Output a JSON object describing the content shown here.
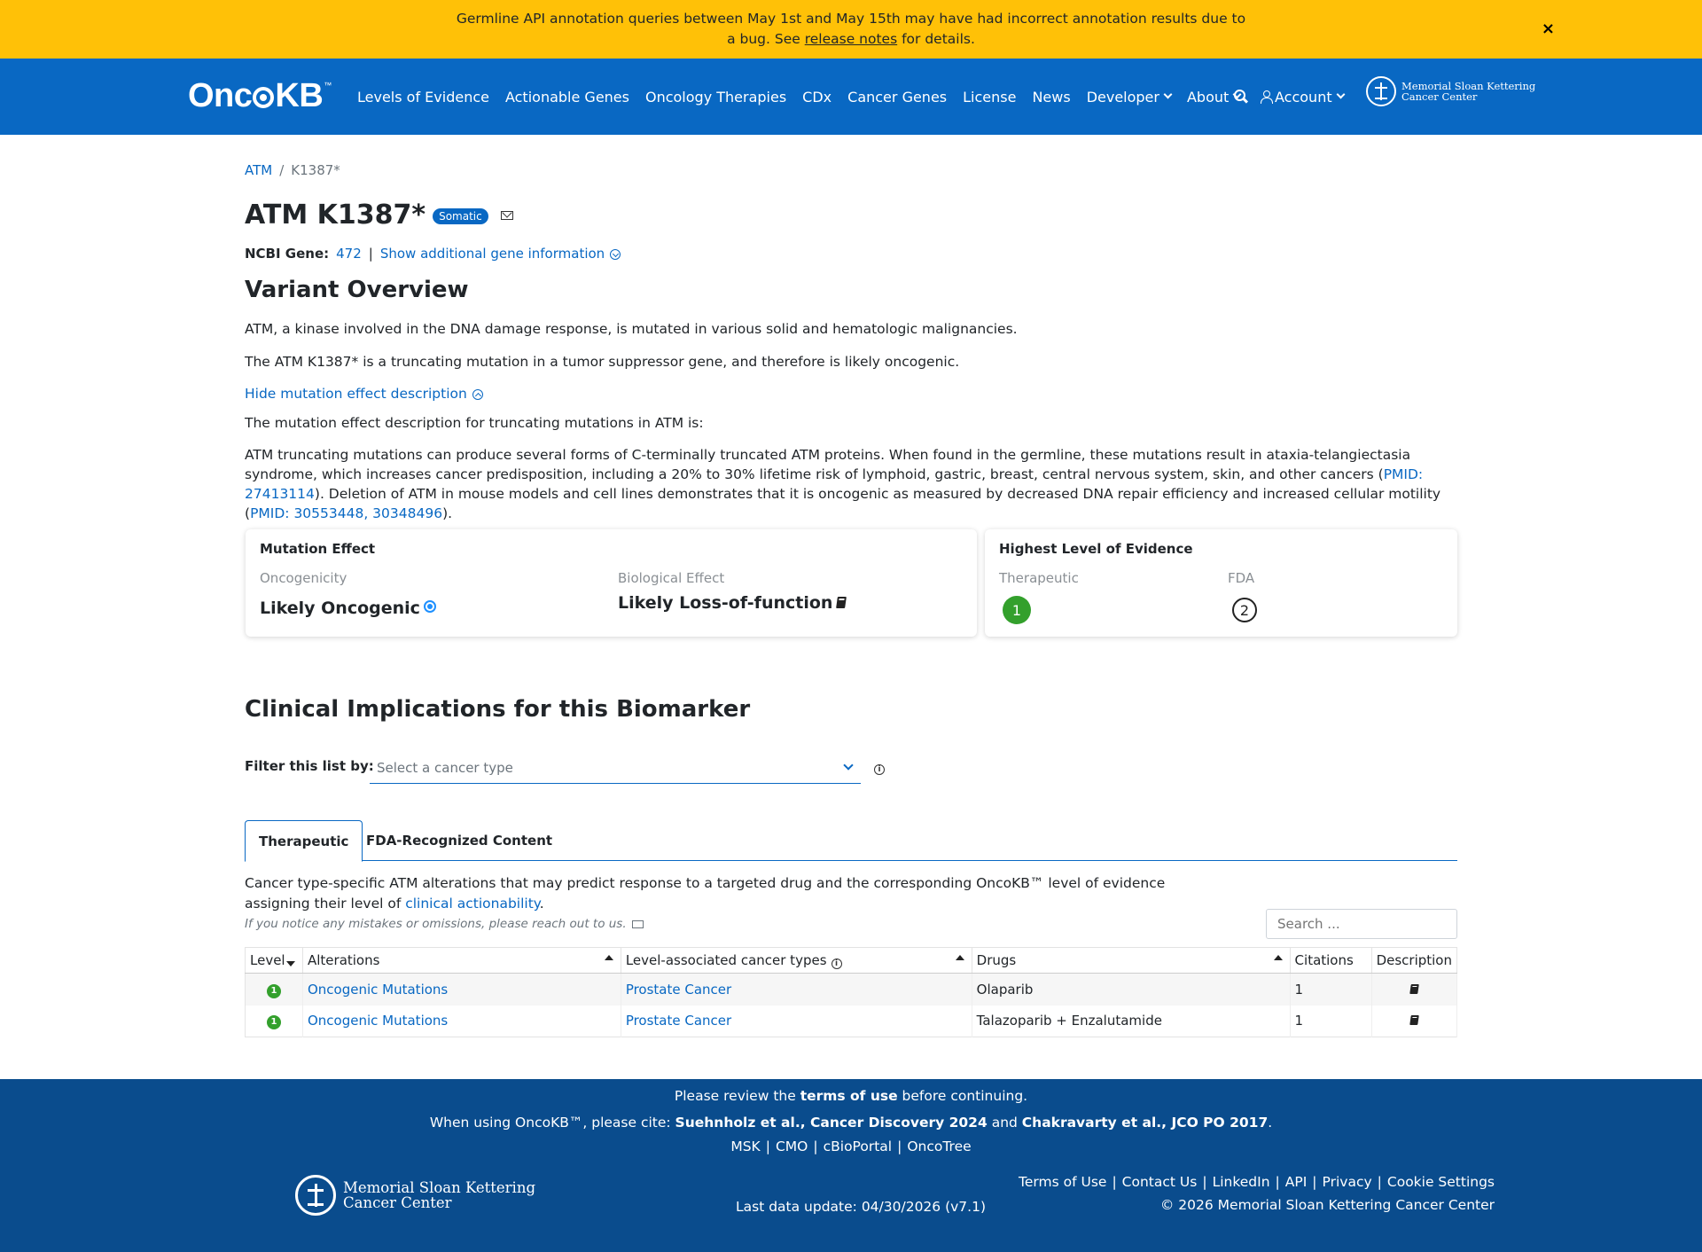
{
  "banner": {
    "text_before": "Germline API annotation queries between May 1st and May 15th may have had incorrect annotation results due to a bug. See ",
    "link": "release notes",
    "text_after": " for details.",
    "close": "×"
  },
  "nav": {
    "logo_a": "Onc",
    "logo_b": "KB",
    "logo_tm": "™",
    "links": [
      "Levels of Evidence",
      "Actionable Genes",
      "Oncology Therapies",
      "CDx",
      "Cancer Genes",
      "License",
      "News",
      "Developer",
      "About"
    ],
    "account": "Account",
    "msk_line1": "Memorial Sloan Kettering",
    "msk_line2": "Cancer Center"
  },
  "breadcrumb": {
    "gene": "ATM",
    "sep": "/",
    "variant": "K1387*"
  },
  "title": {
    "text": "ATM K1387*",
    "badge": "Somatic"
  },
  "ncbi": {
    "label": "NCBI Gene:",
    "id": "472",
    "pipe": "|",
    "show_more": "Show additional gene information"
  },
  "overview": {
    "heading": "Variant Overview",
    "p1": "ATM, a kinase involved in the DNA damage response, is mutated in various solid and hematologic malignancies.",
    "p2": "The ATM K1387* is a truncating mutation in a tumor suppressor gene, and therefore is likely oncogenic.",
    "hide_link": "Hide mutation effect description",
    "p3": "The mutation effect description for truncating mutations in ATM is:",
    "p4_a": "ATM truncating mutations can produce several forms of C-terminally truncated ATM proteins. When found in the germline, these mutations result in ataxia-telangiectasia syndrome, which increases cancer predisposition, including a 20% to 30% lifetime risk of lymphoid, gastric, breast, central nervous system, skin, and other cancers (",
    "p4_link1": "PMID: 27413114",
    "p4_b": "). Deletion of ATM in mouse models and cell lines demonstrates that it is oncogenic as measured by decreased DNA repair efficiency and increased cellular motility (",
    "p4_link2": "PMID: 30553448, 30348496",
    "p4_c": ")."
  },
  "mutation_effect": {
    "title": "Mutation Effect",
    "oncogenicity_label": "Oncogenicity",
    "oncogenicity_value": "Likely Oncogenic",
    "bio_label": "Biological Effect",
    "bio_value": "Likely Loss-of-function"
  },
  "highest_level": {
    "title": "Highest Level of Evidence",
    "therapeutic_label": "Therapeutic",
    "therapeutic_level": "1",
    "fda_label": "FDA",
    "fda_level": "2"
  },
  "clinical": {
    "heading": "Clinical Implications for this Biomarker",
    "filter_label": "Filter this list by:",
    "select_placeholder": "Select a cancer type",
    "info": "i",
    "tabs": [
      "Therapeutic",
      "FDA-Recognized Content"
    ],
    "desc_a": "Cancer type-specific ATM alterations that may predict response to a targeted drug and the corresponding OncoKB™ level of evidence assigning their level of ",
    "desc_link": "clinical actionability",
    "desc_b": ".",
    "reach": "If you notice any mistakes or omissions, please reach out to us.",
    "search_placeholder": "Search ...",
    "columns": [
      "Level",
      "Alterations",
      "Level-associated cancer types",
      "Drugs",
      "Citations",
      "Description"
    ],
    "rows": [
      {
        "level": "1",
        "alteration": "Oncogenic Mutations",
        "cancer": "Prostate Cancer",
        "drugs": "Olaparib",
        "citations": "1"
      },
      {
        "level": "1",
        "alteration": "Oncogenic Mutations",
        "cancer": "Prostate Cancer",
        "drugs": "Talazoparib + Enzalutamide",
        "citations": "1"
      }
    ]
  },
  "footer": {
    "review_a": "Please review the ",
    "review_b": "terms of use",
    "review_c": " before continuing.",
    "cite_a": "When using OncoKB™, please cite: ",
    "cite_b": "Suehnholz et al., Cancer Discovery 2024",
    "cite_c": " and ",
    "cite_d": "Chakravarty et al., JCO PO 2017",
    "cite_e": ".",
    "links_center": [
      "MSK",
      "CMO",
      "cBioPortal",
      "OncoTree"
    ],
    "msk_line1": "Memorial Sloan Kettering",
    "msk_line2": "Cancer Center",
    "last_update": "Last data update: 04/30/2026 (v7.1)",
    "links_right": [
      "Terms of Use",
      "Contact Us",
      "LinkedIn",
      "API",
      "Privacy",
      "Cookie Settings"
    ],
    "copyright": "© 2026 Memorial Sloan Kettering Cancer Center"
  },
  "colors": {
    "banner": "#ffc107",
    "primary": "#0968c3",
    "footer": "#0a4c8d",
    "level1": "#33a02c"
  }
}
